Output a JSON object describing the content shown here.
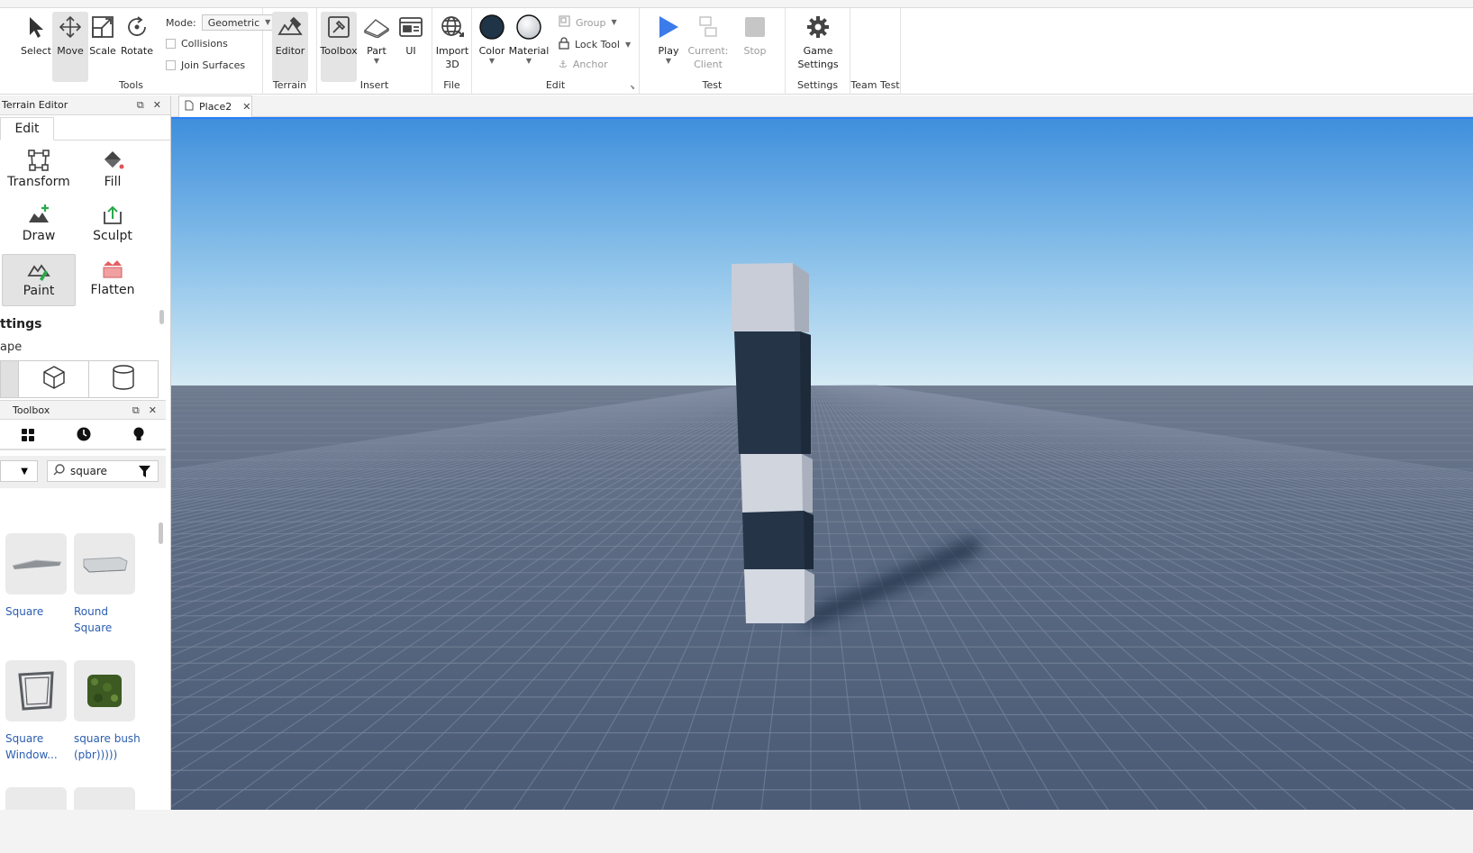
{
  "ribbon": {
    "tools": {
      "label": "Tools",
      "select": "Select",
      "move": "Move",
      "scale": "Scale",
      "rotate": "Rotate",
      "mode_label": "Mode:",
      "mode_value": "Geometric",
      "collisions": "Collisions",
      "join_surfaces": "Join Surfaces"
    },
    "terrain": {
      "label": "Terrain",
      "editor": "Editor"
    },
    "insert": {
      "label": "Insert",
      "toolbox": "Toolbox",
      "part": "Part",
      "ui": "UI"
    },
    "file": {
      "label": "File",
      "import_line1": "Import",
      "import_line2": "3D"
    },
    "edit": {
      "label": "Edit",
      "color": "Color",
      "material": "Material",
      "group": "Group",
      "lock_tool": "Lock Tool",
      "anchor": "Anchor"
    },
    "test": {
      "label": "Test",
      "play": "Play",
      "current_line1": "Current:",
      "current_line2": "Client",
      "stop": "Stop"
    },
    "settings": {
      "label": "Settings",
      "game_line1": "Game",
      "game_line2": "Settings"
    },
    "team_test": {
      "label": "Team Test"
    }
  },
  "terrain_editor": {
    "title": "Terrain Editor",
    "tab_edit": "Edit",
    "tools": {
      "transform": "Transform",
      "fill": "Fill",
      "draw": "Draw",
      "sculpt": "Sculpt",
      "paint": "Paint",
      "flatten": "Flatten"
    },
    "settings_title": "ttings",
    "shape_label": "ape"
  },
  "toolbox": {
    "title": "Toolbox",
    "search_value": "square",
    "assets": [
      {
        "line1": "Square",
        "line2": ""
      },
      {
        "line1": "Round",
        "line2": "Square"
      },
      {
        "line1": "Square",
        "line2": "Window..."
      },
      {
        "line1": "square bush",
        "line2": "(pbr)))))"
      }
    ]
  },
  "document": {
    "tab_name": "Place2"
  },
  "colors": {
    "accent": "#2a7ff5",
    "play": "#3b7bea",
    "dark_part": "#253447",
    "light_part": "#c9ced8"
  }
}
